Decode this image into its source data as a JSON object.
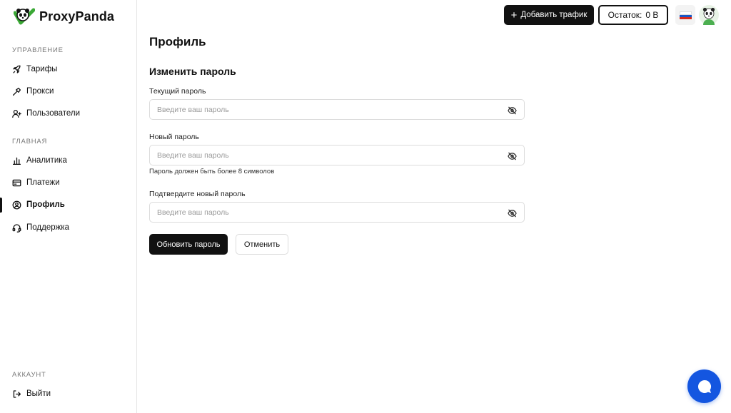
{
  "brand": {
    "name": "ProxyPanda"
  },
  "sidebar": {
    "sections": [
      {
        "title": "УПРАВЛЕНИЕ",
        "items": [
          {
            "label": "Тарифы",
            "icon": "rocket-icon"
          },
          {
            "label": "Прокси",
            "icon": "hammer-icon"
          },
          {
            "label": "Пользователи",
            "icon": "user-add-icon"
          }
        ]
      },
      {
        "title": "ГЛАВНАЯ",
        "items": [
          {
            "label": "Аналитика",
            "icon": "bar-chart-icon"
          },
          {
            "label": "Платежи",
            "icon": "credit-card-icon"
          },
          {
            "label": "Профиль",
            "icon": "user-circle-icon",
            "active": true
          },
          {
            "label": "Поддержка",
            "icon": "headset-icon"
          }
        ]
      },
      {
        "title": "АККАУНТ",
        "items": [
          {
            "label": "Выйти",
            "icon": "logout-icon"
          }
        ]
      }
    ]
  },
  "topbar": {
    "add_traffic_label": "Добавить трафик",
    "balance_label": "Остаток:",
    "balance_value": "0 B",
    "language": "ru",
    "language_flag_colors": [
      "#ffffff",
      "#1c57c4",
      "#d52b1e"
    ]
  },
  "main": {
    "page_title": "Профиль",
    "section_title": "Изменить пароль",
    "fields": [
      {
        "label": "Текущий пароль",
        "placeholder": "Введите ваш пароль",
        "value": ""
      },
      {
        "label": "Новый пароль",
        "placeholder": "Введите ваш пароль",
        "value": "",
        "hint": "Пароль должен быть более 8 символов"
      },
      {
        "label": "Подтвердите новый пароль",
        "placeholder": "Введите ваш пароль",
        "value": ""
      }
    ],
    "submit_label": "Обновить пароль",
    "cancel_label": "Отменить"
  },
  "colors": {
    "primary": "#111111",
    "accent": "#1456e0",
    "border": "#dcdcdc"
  }
}
